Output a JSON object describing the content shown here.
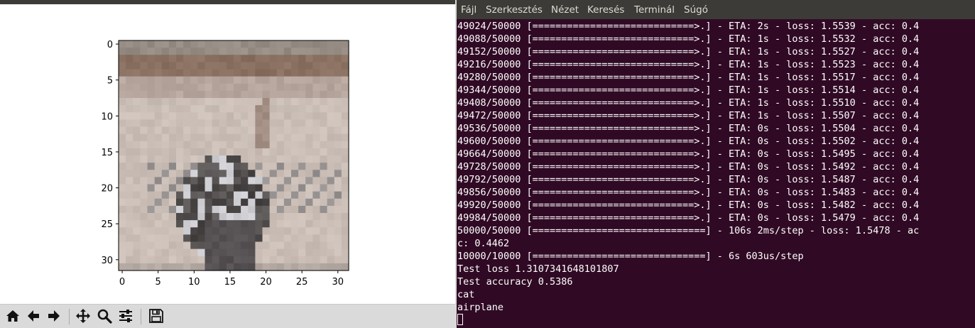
{
  "plot": {
    "y_ticks": [
      "0",
      "5",
      "10",
      "15",
      "20",
      "25",
      "30"
    ],
    "x_ticks": [
      "0",
      "5",
      "10",
      "15",
      "20",
      "25",
      "30"
    ],
    "image_description_colors": {
      "background": "#c8bcb4",
      "dark_band": "#8c6e5c",
      "object": "#55504e"
    }
  },
  "mpl_toolbar": {
    "buttons": [
      "home-icon",
      "back-arrow-icon",
      "forward-arrow-icon",
      "pan-icon",
      "zoom-icon",
      "configure-subplots-icon",
      "save-icon"
    ]
  },
  "terminal": {
    "menu": [
      "Fájl",
      "Szerkesztés",
      "Nézet",
      "Keresés",
      "Terminál",
      "Súgó"
    ],
    "lines": [
      "49024/50000 [============================>.] - ETA: 2s - loss: 1.5539 - acc: 0.4",
      "49088/50000 [============================>.] - ETA: 1s - loss: 1.5532 - acc: 0.4",
      "49152/50000 [============================>.] - ETA: 1s - loss: 1.5527 - acc: 0.4",
      "49216/50000 [============================>.] - ETA: 1s - loss: 1.5523 - acc: 0.4",
      "49280/50000 [============================>.] - ETA: 1s - loss: 1.5517 - acc: 0.4",
      "49344/50000 [============================>.] - ETA: 1s - loss: 1.5514 - acc: 0.4",
      "49408/50000 [============================>.] - ETA: 1s - loss: 1.5510 - acc: 0.4",
      "49472/50000 [============================>.] - ETA: 1s - loss: 1.5507 - acc: 0.4",
      "49536/50000 [============================>.] - ETA: 0s - loss: 1.5504 - acc: 0.4",
      "49600/50000 [============================>.] - ETA: 0s - loss: 1.5502 - acc: 0.4",
      "49664/50000 [============================>.] - ETA: 0s - loss: 1.5495 - acc: 0.4",
      "49728/50000 [============================>.] - ETA: 0s - loss: 1.5492 - acc: 0.4",
      "49792/50000 [============================>.] - ETA: 0s - loss: 1.5487 - acc: 0.4",
      "49856/50000 [============================>.] - ETA: 0s - loss: 1.5483 - acc: 0.4",
      "49920/50000 [============================>.] - ETA: 0s - loss: 1.5482 - acc: 0.4",
      "49984/50000 [============================>.] - ETA: 0s - loss: 1.5479 - acc: 0.4",
      "50000/50000 [==============================] - 106s 2ms/step - loss: 1.5478 - ac",
      "c: 0.4462",
      "10000/10000 [==============================] - 6s 603us/step",
      "Test loss 1.3107341648101807",
      "Test accuracy 0.5386",
      "cat",
      "airplane"
    ]
  }
}
